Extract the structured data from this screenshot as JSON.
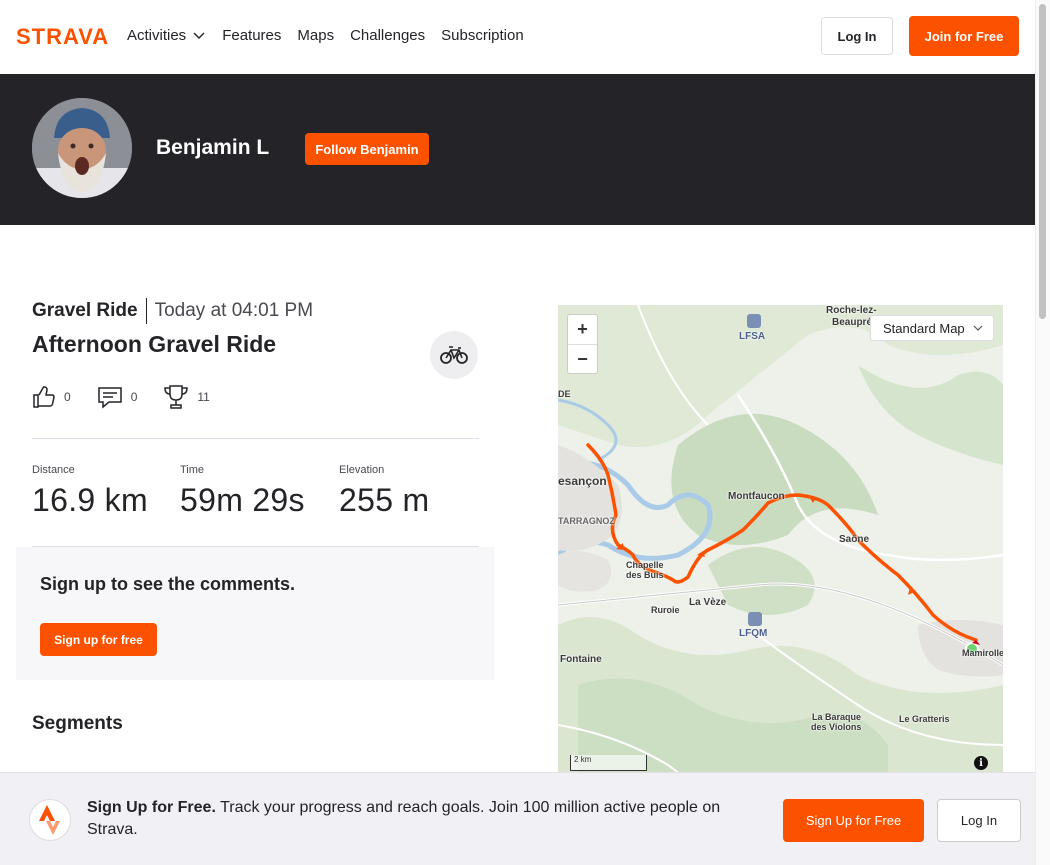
{
  "nav": {
    "logo_text": "STRAVA",
    "links": [
      "Activities",
      "Features",
      "Maps",
      "Challenges",
      "Subscription"
    ],
    "login": "Log In",
    "join": "Join for Free"
  },
  "athlete": {
    "name": "Benjamin L",
    "follow": "Follow Benjamin"
  },
  "activity": {
    "type": "Gravel Ride",
    "date": "Today at 04:01 PM",
    "title": "Afternoon Gravel Ride",
    "kudos": "0",
    "comments": "0",
    "achievements": "11",
    "stats": [
      {
        "label": "Distance",
        "value": "16.9 km"
      },
      {
        "label": "Time",
        "value": "59m 29s"
      },
      {
        "label": "Elevation",
        "value": "255 m"
      }
    ]
  },
  "comments_card": {
    "title": "Sign up to see the comments.",
    "button": "Sign up for free"
  },
  "segments": {
    "title": "Segments"
  },
  "map": {
    "style": "Standard Map",
    "zoom_in": "+",
    "zoom_out": "−",
    "scale": "2 km",
    "info": "i",
    "labels": {
      "roche": "Roche-lez-",
      "beaupre": "Beaupré",
      "lfsa": "LFSA",
      "de": "DE",
      "besancon": "esançon",
      "tarragnoz": "TARRAGNOZ",
      "montfaucon": "Montfaucon",
      "saone": "Saône",
      "chapelle1": "Chapelle",
      "chapelle2": "des Buis",
      "ruroie": "Ruroie",
      "laveze": "La Vèze",
      "lfqm": "LFQM",
      "fontaine": "Fontaine",
      "mamirolle": "Mamirolle",
      "baraque1": "La Baraque",
      "baraque2": "des Violons",
      "gratteris": "Le Gratteris"
    }
  },
  "cta": {
    "bold": "Sign Up for Free.",
    "text": " Track your progress and reach goals. Join 100 million active people on Strava.",
    "signup": "Sign Up for Free",
    "login": "Log In"
  },
  "colors": {
    "brand": "#fc5200",
    "dark_band": "#242428",
    "route": "#fc5200"
  }
}
